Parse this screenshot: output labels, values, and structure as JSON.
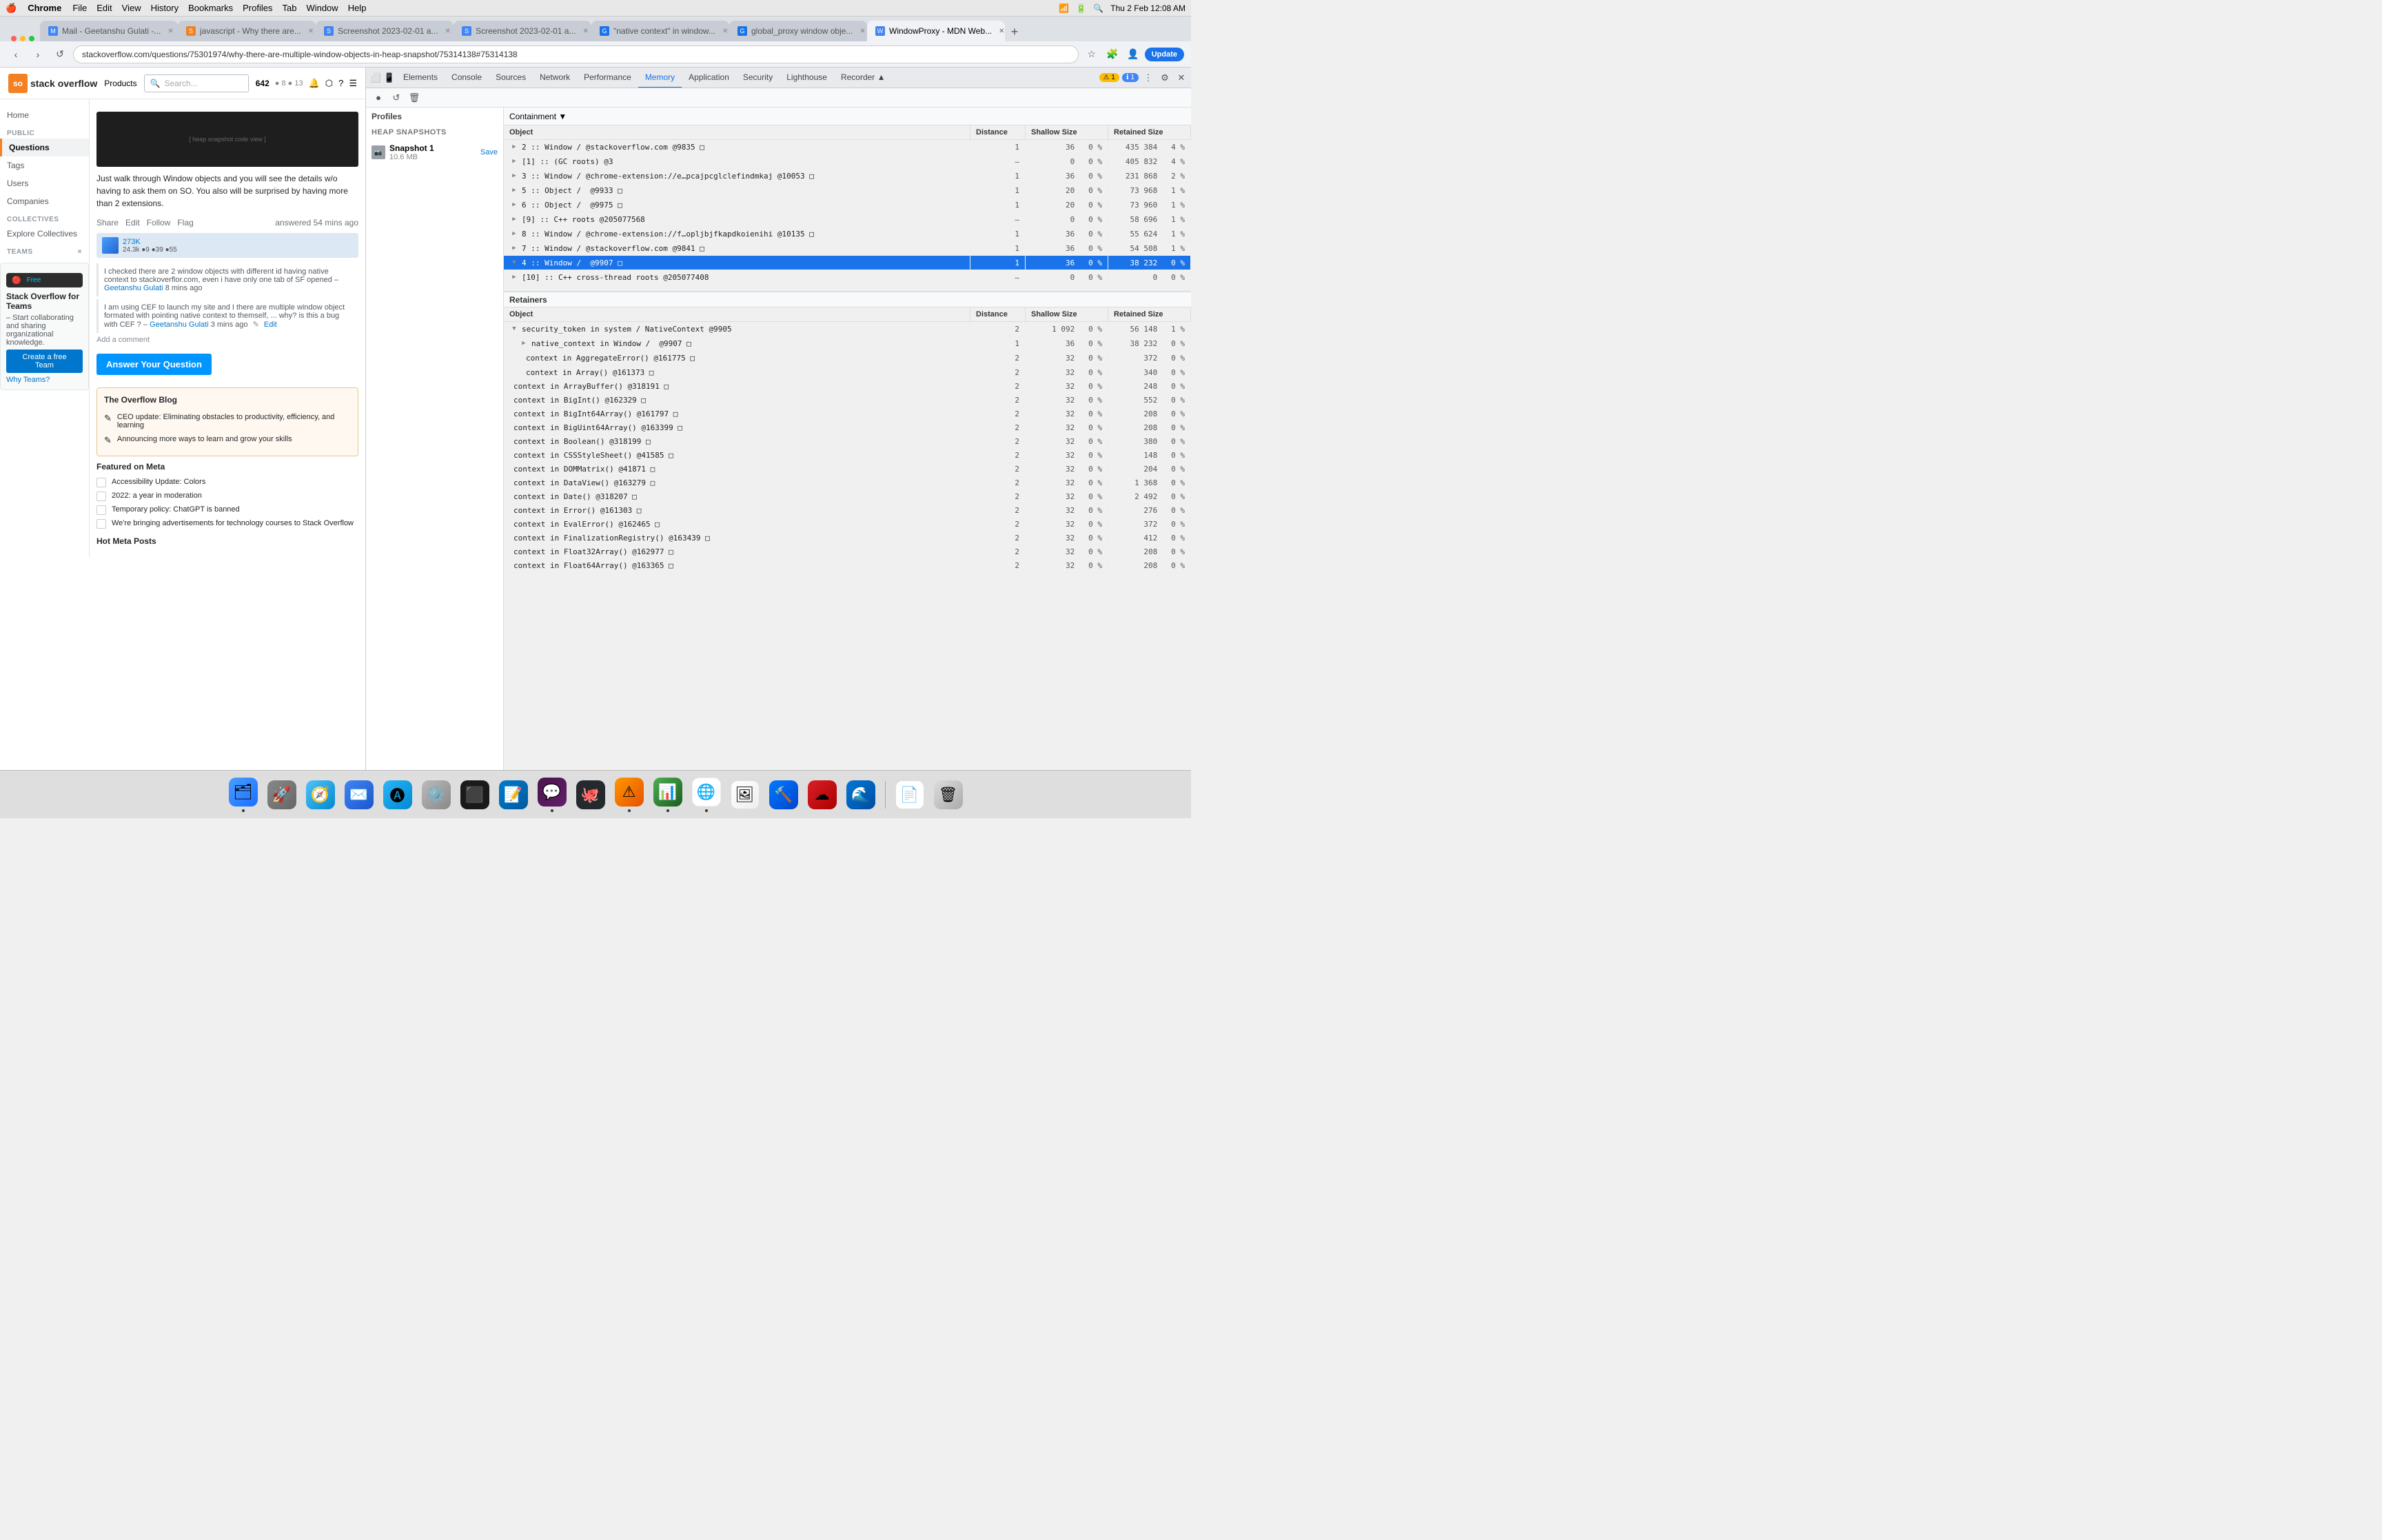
{
  "menubar": {
    "apple": "🍎",
    "app_name": "Chrome",
    "menus": [
      "File",
      "Edit",
      "View",
      "History",
      "Bookmarks",
      "Profiles",
      "Tab",
      "Window",
      "Help"
    ],
    "time": "Thu 2 Feb  12:08 AM"
  },
  "browser": {
    "tabs": [
      {
        "id": "tab1",
        "favicon_color": "#4285f4",
        "favicon_text": "M",
        "label": "Mail - Geetanshu Gulati -...",
        "active": false
      },
      {
        "id": "tab2",
        "favicon_color": "#f48024",
        "favicon_text": "S",
        "label": "javascript - Why there are...",
        "active": false
      },
      {
        "id": "tab3",
        "favicon_color": "#4285f4",
        "favicon_text": "S",
        "label": "Screenshot 2023-02-01 a...",
        "active": false
      },
      {
        "id": "tab4",
        "favicon_color": "#4285f4",
        "favicon_text": "S",
        "label": "Screenshot 2023-02-01 a...",
        "active": false
      },
      {
        "id": "tab5",
        "favicon_color": "#1a73e8",
        "favicon_text": "G",
        "label": "\"native context\" in window...",
        "active": false
      },
      {
        "id": "tab6",
        "favicon_color": "#1a73e8",
        "favicon_text": "G",
        "label": "global_proxy window obje...",
        "active": false
      },
      {
        "id": "tab7",
        "favicon_color": "#4285f4",
        "favicon_text": "W",
        "label": "WindowProxy - MDN Web...",
        "active": true
      }
    ],
    "url": "stackoverflow.com/questions/75301974/why-there-are-multiple-window-objects-in-heap-snapshot/75314138#75314138",
    "update_label": "Update"
  },
  "devtools": {
    "tabs": [
      "Elements",
      "Console",
      "Sources",
      "Network",
      "Performance",
      "Memory",
      "Application",
      "Security",
      "Lighthouse",
      "Recorder ▲"
    ],
    "active_tab": "Memory",
    "toolbar_icons": [
      "●",
      "↺",
      "🗑"
    ],
    "profiles_label": "Profiles",
    "heap_snapshots_label": "HEAP SNAPSHOTS",
    "containment_label": "Containment ▼",
    "retainers_label": "Retainers",
    "table_columns": [
      "Object",
      "Distance",
      "Shallow Size",
      "Retained Size"
    ],
    "snapshot": {
      "name": "Snapshot 1",
      "size": "10.6 MB"
    },
    "rows": [
      {
        "id": "r1",
        "object": "2 :: Window / @stackoverflow.com @9835 □",
        "distance": "1",
        "shallow": "36",
        "shallow_pct": "0 %",
        "retained": "435 384",
        "retained_pct": "4 %",
        "expanded": false
      },
      {
        "id": "r2",
        "object": "[1] :: (GC roots) @3",
        "distance": "—",
        "shallow": "0",
        "shallow_pct": "0 %",
        "retained": "405 832",
        "retained_pct": "4 %",
        "expanded": false
      },
      {
        "id": "r3",
        "object": "3 :: Window / @chrome-extension://e...pcajpcglclefindmkaj @10053 □",
        "distance": "1",
        "shallow": "36",
        "shallow_pct": "0 %",
        "retained": "231 868",
        "retained_pct": "2 %",
        "expanded": false
      },
      {
        "id": "r4",
        "object": "5 :: Object /  @9933 □",
        "distance": "1",
        "shallow": "20",
        "shallow_pct": "0 %",
        "retained": "73 968",
        "retained_pct": "1 %",
        "expanded": false
      },
      {
        "id": "r5",
        "object": "6 :: Object /  @9975 □",
        "distance": "1",
        "shallow": "20",
        "shallow_pct": "0 %",
        "retained": "73 960",
        "retained_pct": "1 %",
        "expanded": false
      },
      {
        "id": "r6",
        "object": "[9] :: C++ roots @205077568",
        "distance": "—",
        "shallow": "0",
        "shallow_pct": "0 %",
        "retained": "58 696",
        "retained_pct": "1 %",
        "expanded": false
      },
      {
        "id": "r7",
        "object": "8 :: Window / @chrome-extension://f...opljbjfkapdkoienihi @10135 □",
        "distance": "1",
        "shallow": "36",
        "shallow_pct": "0 %",
        "retained": "55 624",
        "retained_pct": "1 %",
        "expanded": false
      },
      {
        "id": "r8",
        "object": "7 :: Window / @stackoverflow.com @9841 □",
        "distance": "1",
        "shallow": "36",
        "shallow_pct": "0 %",
        "retained": "54 508",
        "retained_pct": "1 %",
        "expanded": false
      },
      {
        "id": "r9",
        "object": "4 :: Window /  @9907 □",
        "distance": "1",
        "shallow": "36",
        "shallow_pct": "0 %",
        "retained": "38 232",
        "retained_pct": "0 %",
        "selected": true,
        "expanded": true
      },
      {
        "id": "r10",
        "object": "[10] :: C++ cross-thread roots @205077408",
        "distance": "—",
        "shallow": "0",
        "shallow_pct": "0 %",
        "retained": "0",
        "retained_pct": "0 %",
        "expanded": false
      }
    ],
    "retainer_rows": [
      {
        "id": "ret1",
        "object": "▼ security_token in system / NativeContext @9905",
        "distance": "2",
        "shallow": "1 092",
        "shallow_pct": "0 %",
        "retained": "56 148",
        "retained_pct": "1 %",
        "expanded": true
      },
      {
        "id": "ret2",
        "object": "   ▶ native_context in Window /  @9907 □",
        "distance": "1",
        "shallow": "36",
        "shallow_pct": "0 %",
        "retained": "38 232",
        "retained_pct": "0 %",
        "expanded": false
      },
      {
        "id": "ret3",
        "object": "   context in AggregateError() @161775 □",
        "distance": "2",
        "shallow": "32",
        "shallow_pct": "0 %",
        "retained": "372",
        "retained_pct": "0 %",
        "expanded": false
      },
      {
        "id": "ret4",
        "object": "   context in Array() @161373 □",
        "distance": "2",
        "shallow": "32",
        "shallow_pct": "0 %",
        "retained": "340",
        "retained_pct": "0 %",
        "expanded": false
      },
      {
        "id": "ret5",
        "object": "   context in ArrayBuffer() @318191 □",
        "distance": "2",
        "shallow": "32",
        "shallow_pct": "0 %",
        "retained": "248",
        "retained_pct": "0 %",
        "expanded": false
      },
      {
        "id": "ret6",
        "object": "   context in BigInt() @162329 □",
        "distance": "2",
        "shallow": "32",
        "shallow_pct": "0 %",
        "retained": "552",
        "retained_pct": "0 %",
        "expanded": false
      },
      {
        "id": "ret7",
        "object": "   context in BigInt64Array() @161797 □",
        "distance": "2",
        "shallow": "32",
        "shallow_pct": "0 %",
        "retained": "208",
        "retained_pct": "0 %",
        "expanded": false
      },
      {
        "id": "ret8",
        "object": "   context in BigUint64Array() @163399 □",
        "distance": "2",
        "shallow": "32",
        "shallow_pct": "0 %",
        "retained": "208",
        "retained_pct": "0 %",
        "expanded": false
      },
      {
        "id": "ret9",
        "object": "   context in Boolean() @318199 □",
        "distance": "2",
        "shallow": "32",
        "shallow_pct": "0 %",
        "retained": "380",
        "retained_pct": "0 %",
        "expanded": false
      },
      {
        "id": "ret10",
        "object": "   context in CSSStyleSheet() @41585 □",
        "distance": "2",
        "shallow": "32",
        "shallow_pct": "0 %",
        "retained": "148",
        "retained_pct": "0 %",
        "expanded": false
      },
      {
        "id": "ret11",
        "object": "   context in DOMMatrix() @41871 □",
        "distance": "2",
        "shallow": "32",
        "shallow_pct": "0 %",
        "retained": "204",
        "retained_pct": "0 %",
        "expanded": false
      },
      {
        "id": "ret12",
        "object": "   context in DataView() @163279 □",
        "distance": "2",
        "shallow": "32",
        "shallow_pct": "0 %",
        "retained": "1 368",
        "retained_pct": "0 %",
        "expanded": false
      },
      {
        "id": "ret13",
        "object": "   context in Date() @318207 □",
        "distance": "2",
        "shallow": "32",
        "shallow_pct": "0 %",
        "retained": "2 492",
        "retained_pct": "0 %",
        "expanded": false
      },
      {
        "id": "ret14",
        "object": "   context in Error() @161303 □",
        "distance": "2",
        "shallow": "32",
        "shallow_pct": "0 %",
        "retained": "276",
        "retained_pct": "0 %",
        "expanded": false
      },
      {
        "id": "ret15",
        "object": "   context in EvalError() @162465 □",
        "distance": "2",
        "shallow": "32",
        "shallow_pct": "0 %",
        "retained": "372",
        "retained_pct": "0 %",
        "expanded": false
      },
      {
        "id": "ret16",
        "object": "   context in FinalizationRegistry() @163439 □",
        "distance": "2",
        "shallow": "32",
        "shallow_pct": "0 %",
        "retained": "412",
        "retained_pct": "0 %",
        "expanded": false
      },
      {
        "id": "ret17",
        "object": "   context in Float32Array() @162977 □",
        "distance": "2",
        "shallow": "32",
        "shallow_pct": "0 %",
        "retained": "208",
        "retained_pct": "0 %",
        "expanded": false
      },
      {
        "id": "ret18",
        "object": "   context in Float64Array() @163365 □",
        "distance": "2",
        "shallow": "32",
        "shallow_pct": "0 %",
        "retained": "208",
        "retained_pct": "0 %",
        "expanded": false
      }
    ]
  },
  "stackoverflow": {
    "logo_text": "stack overflow",
    "products_label": "Products",
    "search_placeholder": "Search...",
    "reputation": "642",
    "badges": "● 8  ● 13",
    "nav": {
      "home": "Home",
      "public": "PUBLIC",
      "questions": "Questions",
      "tags": "Tags",
      "users": "Users",
      "companies": "Companies",
      "collectives": "COLLECTIVES",
      "explore_collectives": "Explore Collectives",
      "teams": "TEAMS",
      "close": "×"
    },
    "teams_box": {
      "title": "Stack Overflow for Teams",
      "description": "– Start collaborating and sharing organizational knowledge.",
      "create_team": "Create a free Team",
      "why_teams": "Why Teams?"
    },
    "answer": {
      "body_1": "Just walk through Window objects and you will see the details w/o having to ask them on SO. You also will be surprised by having more than 2 extensions.",
      "share": "Share",
      "edit": "Edit",
      "follow": "Follow",
      "flag": "Flag",
      "answered_when": "answered 54 mins ago",
      "rep": "273K",
      "rep2": "24.3k",
      "comment_1": "I checked there are 2 window objects with different id having native context to stackoverflor.com, even i have only one tab of SF opened –",
      "commenter_1": "Geetanshu Gulati",
      "comment_1_time": "8 mins ago",
      "comment_2": "I am using CEF to launch my site and I there are multiple window object formated with pointing native context to themself, ... why? is this a bug with CEF ? –",
      "commenter_2": "Geetanshu Gulati",
      "comment_2_time": "3 mins ago",
      "edit_link": "Edit",
      "add_comment": "Add a comment"
    },
    "answer_btn": "Answer Your Question",
    "blog": {
      "title": "The Overflow Blog",
      "item1": "CEO update: Eliminating obstacles to productivity, efficiency, and learning",
      "item2": "Announcing more ways to learn and grow your skills"
    },
    "featured": {
      "title": "Featured on Meta",
      "items": [
        "Accessibility Update: Colors",
        "2022: a year in moderation",
        "Temporary policy: ChatGPT is banned",
        "We're bringing advertisements for technology courses to Stack Overflow"
      ]
    },
    "hot_meta": "Hot Meta Posts"
  },
  "dock": {
    "items": [
      {
        "id": "finder",
        "emoji": "🗂",
        "color": "#1a73e8",
        "label": "Finder"
      },
      {
        "id": "launchpad",
        "emoji": "🚀",
        "color": "#888",
        "label": "Launchpad"
      },
      {
        "id": "safari",
        "emoji": "🧭",
        "color": "#1a73e8",
        "label": "Safari"
      },
      {
        "id": "mail",
        "emoji": "✉️",
        "color": "#4285f4",
        "label": "Mail"
      },
      {
        "id": "appstore",
        "emoji": "🅰",
        "color": "#4285f4",
        "label": "App Store"
      },
      {
        "id": "sysprefs",
        "emoji": "⚙️",
        "color": "#888",
        "label": "System Preferences"
      },
      {
        "id": "terminal",
        "emoji": "⬛",
        "color": "#333",
        "label": "Terminal"
      },
      {
        "id": "vscode",
        "emoji": "📝",
        "color": "#007acc",
        "label": "VS Code"
      },
      {
        "id": "slack",
        "emoji": "💬",
        "color": "#4a154b",
        "label": "Slack"
      },
      {
        "id": "github",
        "emoji": "🐙",
        "color": "#24292e",
        "label": "GitHub Desktop"
      },
      {
        "id": "console",
        "emoji": "⚠",
        "color": "#ff9800",
        "label": "Console"
      },
      {
        "id": "actmon",
        "emoji": "📊",
        "color": "#4caf50",
        "label": "Activity Monitor"
      },
      {
        "id": "chrome",
        "emoji": "🌐",
        "color": "#4285f4",
        "label": "Chrome"
      },
      {
        "id": "preview",
        "emoji": "🖼",
        "color": "#eee",
        "label": "Preview"
      },
      {
        "id": "xcode",
        "emoji": "🔨",
        "color": "#007aff",
        "label": "Xcode"
      },
      {
        "id": "creative_cloud",
        "emoji": "☁",
        "color": "#da1f26",
        "label": "Creative Cloud"
      },
      {
        "id": "edge",
        "emoji": "🌊",
        "color": "#0078d7",
        "label": "Edge"
      },
      {
        "id": "text_edit",
        "emoji": "📄",
        "color": "#fff",
        "label": "TextEdit"
      },
      {
        "id": "trash",
        "emoji": "🗑",
        "color": "#888",
        "label": "Trash"
      }
    ]
  }
}
